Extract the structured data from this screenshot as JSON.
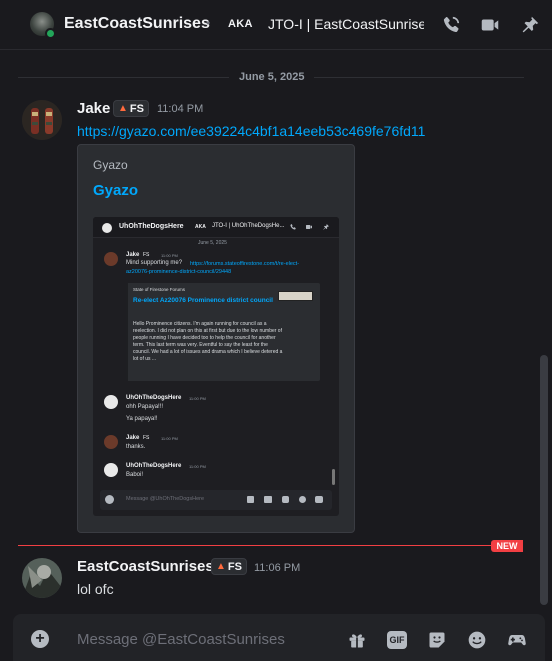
{
  "header": {
    "name": "EastCoastSunrises",
    "separator": "•",
    "aka_label": "AKA",
    "aka_name": "JTO-I | EastCoastSunrises"
  },
  "date_divider": "June 5, 2025",
  "messages": [
    {
      "username": "Jake",
      "tag": "FS",
      "time": "11:04 PM",
      "link": "https://gyazo.com/ee39224c4bf1a14eeb53c469fe76fd11",
      "embed": {
        "provider": "Gyazo",
        "title": "Gyazo",
        "screenshot": {
          "header_name": "UhOhTheDogsHere",
          "aka_label": "AKA",
          "aka_name": "JTO-I | UhOhTheDogsHe...",
          "date": "June 5, 2025",
          "messages": [
            {
              "username": "Jake",
              "tag": "FS",
              "time": "11:00 PM",
              "text": "Mind supporting me?",
              "link": "https://forums.stateoffirestone.com/t/re-elect-az20076-prominence-district-council/29448",
              "embed": {
                "provider": "State of Firestone Forums",
                "title": "Re-elect Az20076 Prominence district council",
                "body": "Hello Prominence citizens. I'm again running for council as a reelection. I did not plan on this at first but due to the low number of people running I have decided too to help the council for another term. This last term was very. Eventful to say the least for the council. We had a lot of issues and drama which I believe detered a lot of us ..."
              }
            },
            {
              "username": "UhOhTheDogsHere",
              "time": "11:00 PM",
              "lines": [
                "ohh Papaya!!!",
                "Ya papaya!!"
              ]
            },
            {
              "username": "Jake",
              "tag": "FS",
              "time": "11:00 PM",
              "lines": [
                "thanks."
              ]
            },
            {
              "username": "UhOhTheDogsHere",
              "time": "11:00 PM",
              "lines": [
                "Baboi!"
              ]
            }
          ],
          "composer_placeholder": "Message @UhOhTheDogsHere"
        }
      }
    },
    {
      "username": "EastCoastSunrises",
      "tag": "FS",
      "time": "11:06 PM",
      "text": "lol ofc"
    }
  ],
  "new_badge": "NEW",
  "composer": {
    "placeholder": "Message @EastCoastSunrises",
    "gif_label": "GIF"
  },
  "icons": {
    "header": [
      "call-icon",
      "video-icon",
      "pin-icon"
    ],
    "composer": [
      "plus-icon",
      "gift-icon",
      "gif-icon",
      "sticker-icon",
      "emoji-icon",
      "activities-icon"
    ]
  },
  "colors": {
    "background": "#1a1a1e",
    "link": "#00a8fc",
    "online": "#23a55a",
    "new": "#f23f43"
  }
}
